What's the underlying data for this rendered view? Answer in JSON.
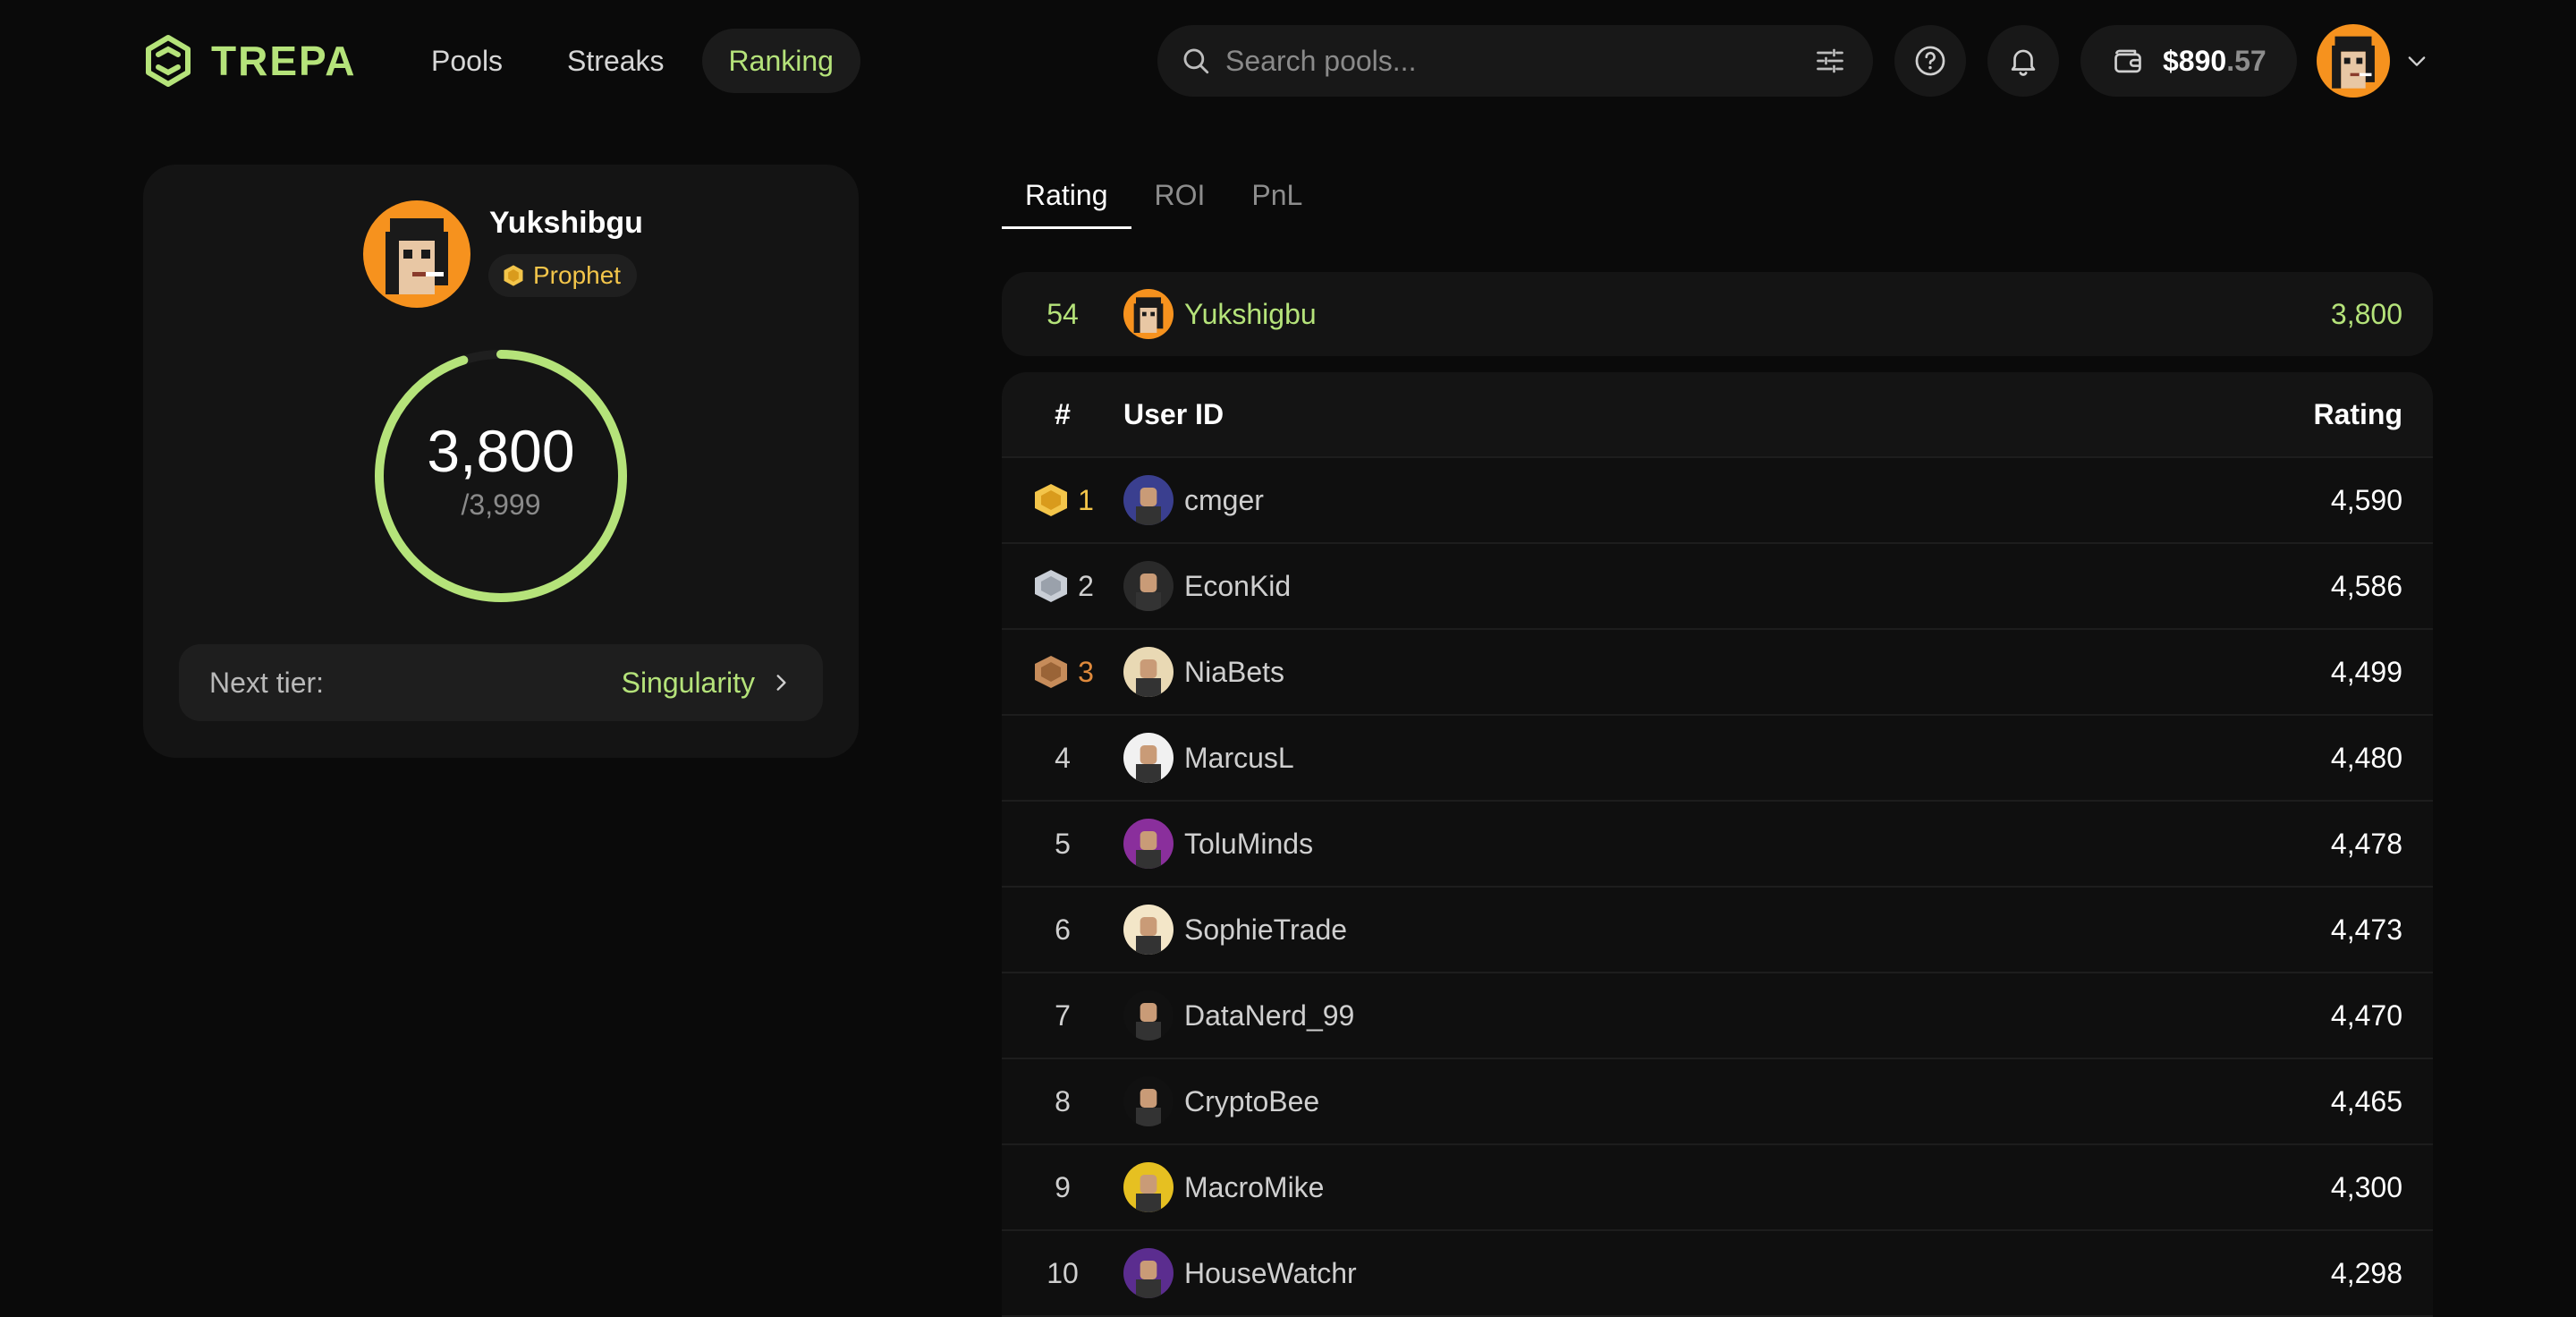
{
  "brand": {
    "name": "TREPA",
    "accent": "#b5e37a"
  },
  "nav": [
    {
      "label": "Pools",
      "active": false
    },
    {
      "label": "Streaks",
      "active": false
    },
    {
      "label": "Ranking",
      "active": true
    }
  ],
  "search": {
    "placeholder": "Search pools...",
    "icon": "search-icon",
    "filter_icon": "sliders-icon"
  },
  "header_icons": [
    "help-icon",
    "bell-icon"
  ],
  "wallet": {
    "icon": "wallet-icon",
    "amount": "$890",
    "cents": ".57"
  },
  "profile": {
    "name": "Yukshibgu",
    "badge": "Prophet",
    "rating": "3,800",
    "max": "/3,999",
    "progress": 0.95,
    "next_tier_label": "Next tier:",
    "next_tier_value": "Singularity"
  },
  "tabs": [
    {
      "label": "Rating",
      "active": true
    },
    {
      "label": "ROI",
      "active": false
    },
    {
      "label": "PnL",
      "active": false
    }
  ],
  "my_rank": {
    "rank": "54",
    "user": "Yukshigbu",
    "rating": "3,800"
  },
  "table": {
    "headers": {
      "rank": "#",
      "user": "User ID",
      "rating": "Rating"
    },
    "rows": [
      {
        "rank": "1",
        "user": "cmger",
        "rating": "4,590",
        "medal": "gold"
      },
      {
        "rank": "2",
        "user": "EconKid",
        "rating": "4,586",
        "medal": "silver"
      },
      {
        "rank": "3",
        "user": "NiaBets",
        "rating": "4,499",
        "medal": "bronze"
      },
      {
        "rank": "4",
        "user": "MarcusL",
        "rating": "4,480",
        "medal": ""
      },
      {
        "rank": "5",
        "user": "ToluMinds",
        "rating": "4,478",
        "medal": ""
      },
      {
        "rank": "6",
        "user": "SophieTrade",
        "rating": "4,473",
        "medal": ""
      },
      {
        "rank": "7",
        "user": "DataNerd_99",
        "rating": "4,470",
        "medal": ""
      },
      {
        "rank": "8",
        "user": "CryptoBee",
        "rating": "4,465",
        "medal": ""
      },
      {
        "rank": "9",
        "user": "MacroMike",
        "rating": "4,300",
        "medal": ""
      },
      {
        "rank": "10",
        "user": "HouseWatchr",
        "rating": "4,298",
        "medal": ""
      }
    ]
  }
}
